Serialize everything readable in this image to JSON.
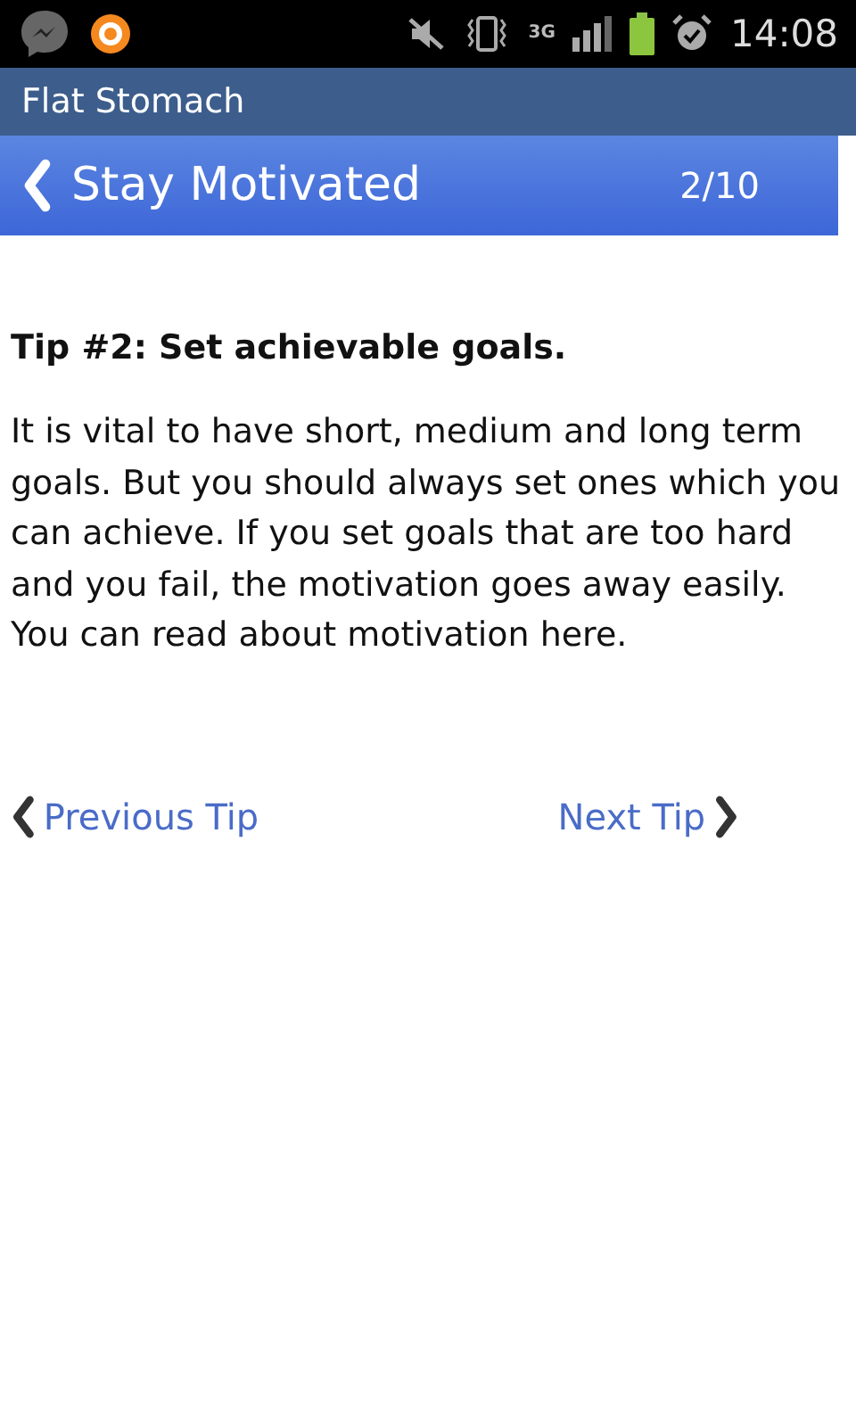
{
  "status_bar": {
    "network": "3G",
    "time": "14:08"
  },
  "app_title": "Flat Stomach",
  "header": {
    "title": "Stay Motivated",
    "counter": "2/10"
  },
  "tip": {
    "heading": "Tip #2: Set achievable goals.",
    "body": "It is vital to have short, medium and long term goals. But you should always set ones which you can achieve. If you set goals that are too hard and you fail, the motivation goes away easily. You can read about motivation here."
  },
  "nav": {
    "previous": "Previous Tip",
    "next": "Next Tip"
  }
}
